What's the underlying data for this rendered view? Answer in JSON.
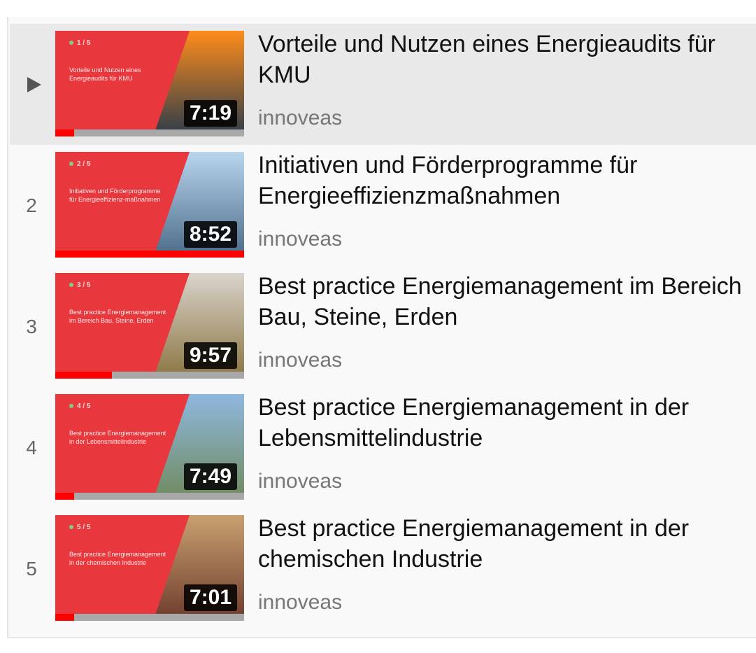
{
  "playlist": {
    "items": [
      {
        "index": "",
        "active": true,
        "title": "Vorteile und Nutzen eines Energieaudits für KMU",
        "channel": "innoveas",
        "duration": "7:19",
        "progress": 0.1,
        "thumb_counter": "1 / 5",
        "thumb_caption": "Vorteile und Nutzen eines Energieaudits für KMU",
        "photo": [
          "#ff8c1a",
          "#2a3b4c"
        ]
      },
      {
        "index": "2",
        "active": false,
        "title": "Initiativen und Förderprogramme für Energieeffizienzmaßnahmen",
        "channel": "innoveas",
        "duration": "8:52",
        "progress": 1.0,
        "thumb_counter": "2 / 5",
        "thumb_caption": "Initiativen und Förderprogramme für Energieeffizienz-maßnahmen",
        "photo": [
          "#b9d6ee",
          "#4a6a88"
        ]
      },
      {
        "index": "3",
        "active": false,
        "title": "Best practice Energiemanagement im Bereich Bau, Steine, Erden",
        "channel": "innoveas",
        "duration": "9:57",
        "progress": 0.3,
        "thumb_counter": "3 / 5",
        "thumb_caption": "Best practice Energiemanagement im Bereich Bau, Steine, Erden",
        "photo": [
          "#d9d4cc",
          "#8a7440"
        ]
      },
      {
        "index": "4",
        "active": false,
        "title": "Best practice Energiemanagement in der Lebensmittelindustrie",
        "channel": "innoveas",
        "duration": "7:49",
        "progress": 0.1,
        "thumb_counter": "4 / 5",
        "thumb_caption": "Best practice Energiemanagement in der Lebensmittelindustrie",
        "photo": [
          "#8fb8de",
          "#6f8a5e"
        ]
      },
      {
        "index": "5",
        "active": false,
        "title": "Best practice Energiemanagement in der chemischen Industrie",
        "channel": "innoveas",
        "duration": "7:01",
        "progress": 0.1,
        "thumb_counter": "5 / 5",
        "thumb_caption": "Best practice Energiemanagement in der chemischen Industrie",
        "photo": [
          "#c8a070",
          "#6e3b2c"
        ]
      }
    ]
  },
  "colors": {
    "thumb_red": "#e8383d",
    "progress_red": "#ff0000",
    "active_row_bg": "#e9e9e9"
  }
}
